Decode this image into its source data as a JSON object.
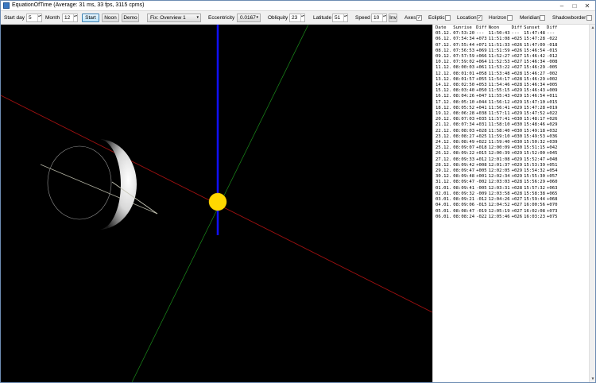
{
  "window": {
    "title": "EquationOfTime (Average: 31 ms, 33 fps, 3115 cpms)",
    "controls": {
      "minimize": "–",
      "maximize": "□",
      "close": "✕"
    }
  },
  "toolbar": {
    "start_day_label": "Start day",
    "start_day_value": "5",
    "month_label": "Month",
    "month_value": "12",
    "start_button": "Start",
    "noon_button": "Noon",
    "demo_button": "Demo",
    "fix_combo_value": "Fix: Overview 1",
    "eccentricity_label": "Eccentricity",
    "eccentricity_value": "0.0167",
    "obliquity_label": "Obliquity",
    "obliquity_value": "23",
    "latitude_label": "Latitude",
    "latitude_value": "51",
    "speed_label": "Speed",
    "speed_value": "10",
    "inv_button": "Inv",
    "axes_label": "Axes",
    "axes_checked": "✓",
    "ecliptic_label": "Ecliptic",
    "ecliptic_checked": "",
    "location_label": "Location",
    "location_checked": "✓",
    "horizon_label": "Horizon",
    "horizon_checked": "",
    "meridian_label": "Meridian",
    "meridian_checked": "",
    "shadowborder_label": "Shadowborder",
    "shadowborder_checked": ""
  },
  "icons": {
    "spin_arrows": "▴▾",
    "combo_caret": "▾",
    "scroll_up": "▲",
    "scroll_down": "▼"
  },
  "colors": {
    "x_axis": "#a01010",
    "y_axis": "#1a8a1a",
    "z_axis": "#1010ff",
    "sun": "#ffd700",
    "background": "#000000"
  },
  "table": {
    "headers": [
      "Date",
      "Sunrise",
      "Diff",
      "Noon",
      "Diff",
      "Sunset",
      "Diff"
    ],
    "rows": [
      [
        "05.12.",
        "07:53:20",
        "---",
        "11:50:43",
        "---",
        "15:47:48",
        "---"
      ],
      [
        "06.12.",
        "07:54:34",
        "+073",
        "11:51:08",
        "+025",
        "15:47:28",
        "-022"
      ],
      [
        "07.12.",
        "07:55:44",
        "+071",
        "11:51:33",
        "+026",
        "15:47:09",
        "-018"
      ],
      [
        "08.12.",
        "07:56:53",
        "+069",
        "11:51:59",
        "+026",
        "15:46:54",
        "-015"
      ],
      [
        "09.12.",
        "07:57:59",
        "+066",
        "11:52:27",
        "+027",
        "15:46:42",
        "-012"
      ],
      [
        "10.12.",
        "07:59:02",
        "+064",
        "11:52:53",
        "+027",
        "15:46:34",
        "-008"
      ],
      [
        "11.12.",
        "08:00:03",
        "+061",
        "11:53:22",
        "+027",
        "15:46:29",
        "-005"
      ],
      [
        "12.12.",
        "08:01:01",
        "+058",
        "11:53:48",
        "+028",
        "15:46:27",
        "-002"
      ],
      [
        "13.12.",
        "08:01:57",
        "+055",
        "11:54:17",
        "+028",
        "15:46:29",
        "+002"
      ],
      [
        "14.12.",
        "08:02:50",
        "+053",
        "11:54:46",
        "+028",
        "15:46:34",
        "+005"
      ],
      [
        "15.12.",
        "08:03:40",
        "+050",
        "11:55:15",
        "+029",
        "15:46:43",
        "+009"
      ],
      [
        "16.12.",
        "08:04:26",
        "+047",
        "11:55:43",
        "+029",
        "15:46:54",
        "+011"
      ],
      [
        "17.12.",
        "08:05:10",
        "+044",
        "11:56:12",
        "+029",
        "15:47:10",
        "+015"
      ],
      [
        "18.12.",
        "08:05:52",
        "+041",
        "11:56:41",
        "+029",
        "15:47:28",
        "+019"
      ],
      [
        "19.12.",
        "08:06:28",
        "+038",
        "11:57:11",
        "+029",
        "15:47:52",
        "+022"
      ],
      [
        "20.12.",
        "08:07:03",
        "+035",
        "11:57:41",
        "+030",
        "15:48:17",
        "+026"
      ],
      [
        "21.12.",
        "08:07:34",
        "+031",
        "11:58:10",
        "+030",
        "15:48:46",
        "+029"
      ],
      [
        "22.12.",
        "08:08:03",
        "+028",
        "11:58:40",
        "+030",
        "15:49:18",
        "+032"
      ],
      [
        "23.12.",
        "08:08:27",
        "+025",
        "11:59:10",
        "+030",
        "15:49:53",
        "+036"
      ],
      [
        "24.12.",
        "08:08:49",
        "+022",
        "11:59:40",
        "+030",
        "15:50:32",
        "+039"
      ],
      [
        "25.12.",
        "08:09:07",
        "+018",
        "12:00:09",
        "+030",
        "15:51:15",
        "+042"
      ],
      [
        "26.12.",
        "08:09:22",
        "+015",
        "12:00:39",
        "+029",
        "15:52:00",
        "+045"
      ],
      [
        "27.12.",
        "08:09:33",
        "+012",
        "12:01:08",
        "+029",
        "15:52:47",
        "+048"
      ],
      [
        "28.12.",
        "08:09:42",
        "+008",
        "12:01:37",
        "+029",
        "15:53:39",
        "+051"
      ],
      [
        "29.12.",
        "08:09:47",
        "+005",
        "12:02:05",
        "+029",
        "15:54:32",
        "+054"
      ],
      [
        "30.12.",
        "08:09:48",
        "+001",
        "12:02:34",
        "+029",
        "15:55:30",
        "+057"
      ],
      [
        "31.12.",
        "08:09:47",
        "-002",
        "12:03:03",
        "+028",
        "15:56:29",
        "+060"
      ],
      [
        "01.01.",
        "08:09:41",
        "-005",
        "12:03:31",
        "+028",
        "15:57:32",
        "+063"
      ],
      [
        "02.01.",
        "08:09:32",
        "-009",
        "12:03:58",
        "+028",
        "15:58:38",
        "+065"
      ],
      [
        "03.01.",
        "08:09:21",
        "-012",
        "12:04:26",
        "+027",
        "15:59:44",
        "+068"
      ],
      [
        "04.01.",
        "08:09:06",
        "-015",
        "12:04:52",
        "+027",
        "16:00:56",
        "+070"
      ],
      [
        "05.01.",
        "08:08:47",
        "-019",
        "12:05:19",
        "+027",
        "16:02:08",
        "+073"
      ],
      [
        "06.01.",
        "08:08:24",
        "-022",
        "12:05:46",
        "+026",
        "16:03:23",
        "+075"
      ]
    ]
  }
}
